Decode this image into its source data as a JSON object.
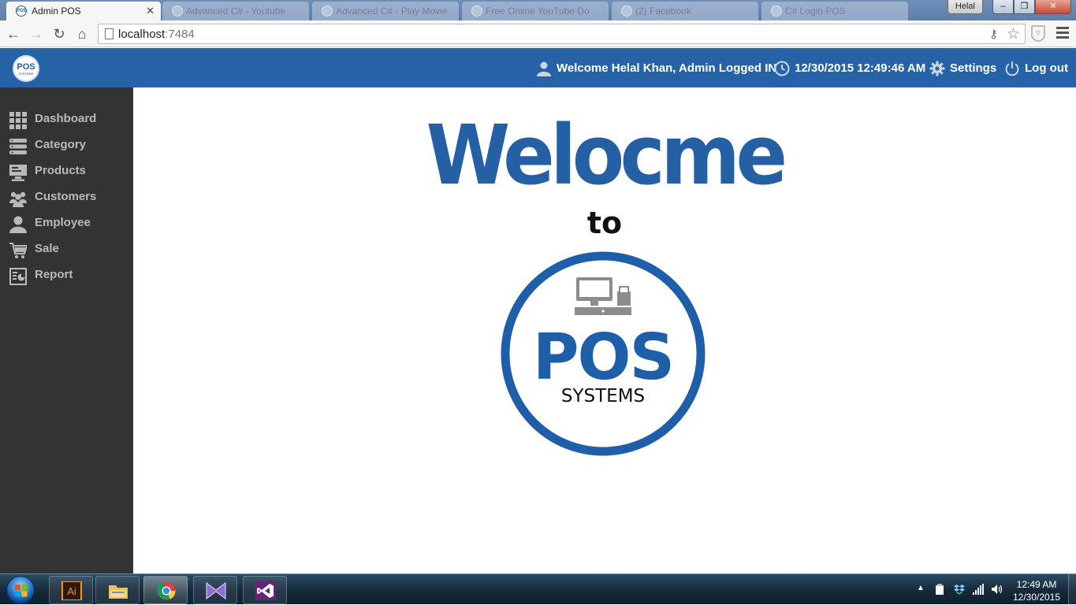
{
  "browser": {
    "active_tab": {
      "title": "Admin POS",
      "close_glyph": "✕",
      "favicon": "POS"
    },
    "background_tabs": [
      "Advanced C# - Youtube",
      "Advanced C# - Play Movie",
      "Free Online YouTube Do",
      "(2) Facebook",
      "C# Login POS"
    ],
    "user_chip": "Helal",
    "window_buttons": {
      "minimize": "‒",
      "maximize": "❐",
      "close": "✕"
    },
    "url_host": "localhost",
    "url_port": ":7484",
    "icons": [
      "back-icon",
      "forward-icon",
      "reload-icon",
      "home-icon",
      "page-icon",
      "key-icon",
      "star-icon",
      "shield-extension-icon",
      "menu-icon"
    ]
  },
  "header": {
    "logo_main": "POS",
    "logo_sub": "SYSTEMS",
    "welcome": "Welcome Helal Khan, Admin Logged IN",
    "datetime": "12/30/2015 12:49:46 AM",
    "settings": "Settings",
    "logout": "Log out",
    "colors": {
      "bar": "#2663a6",
      "sidebar": "#333333",
      "sidebar_text": "#b9b9b9"
    }
  },
  "sidebar": {
    "items": [
      {
        "label": "Dashboard",
        "icon": "grid-icon"
      },
      {
        "label": "Category",
        "icon": "stack-icon"
      },
      {
        "label": "Products",
        "icon": "monitor-icon"
      },
      {
        "label": "Customers",
        "icon": "users-icon"
      },
      {
        "label": "Employee",
        "icon": "user-icon"
      },
      {
        "label": "Sale",
        "icon": "cart-icon"
      },
      {
        "label": "Report",
        "icon": "report-icon"
      }
    ]
  },
  "main": {
    "title": "Welocme",
    "subtitle": "to",
    "emblem_main": "POS",
    "emblem_sub": "SYSTEMS",
    "colors": {
      "title": "#2660a4",
      "emblem_ring": "#1f5ea8",
      "emblem_terminal": "#8c8c8c"
    }
  },
  "taskbar": {
    "apps": [
      "windows-explorer",
      "adobe-illustrator",
      "file-explorer",
      "google-chrome",
      "visual-studio-blend",
      "visual-studio"
    ],
    "illustrator_label": "Ai",
    "time": "12:49 AM",
    "date": "12/30/2015",
    "tray_arrow": "▲"
  }
}
